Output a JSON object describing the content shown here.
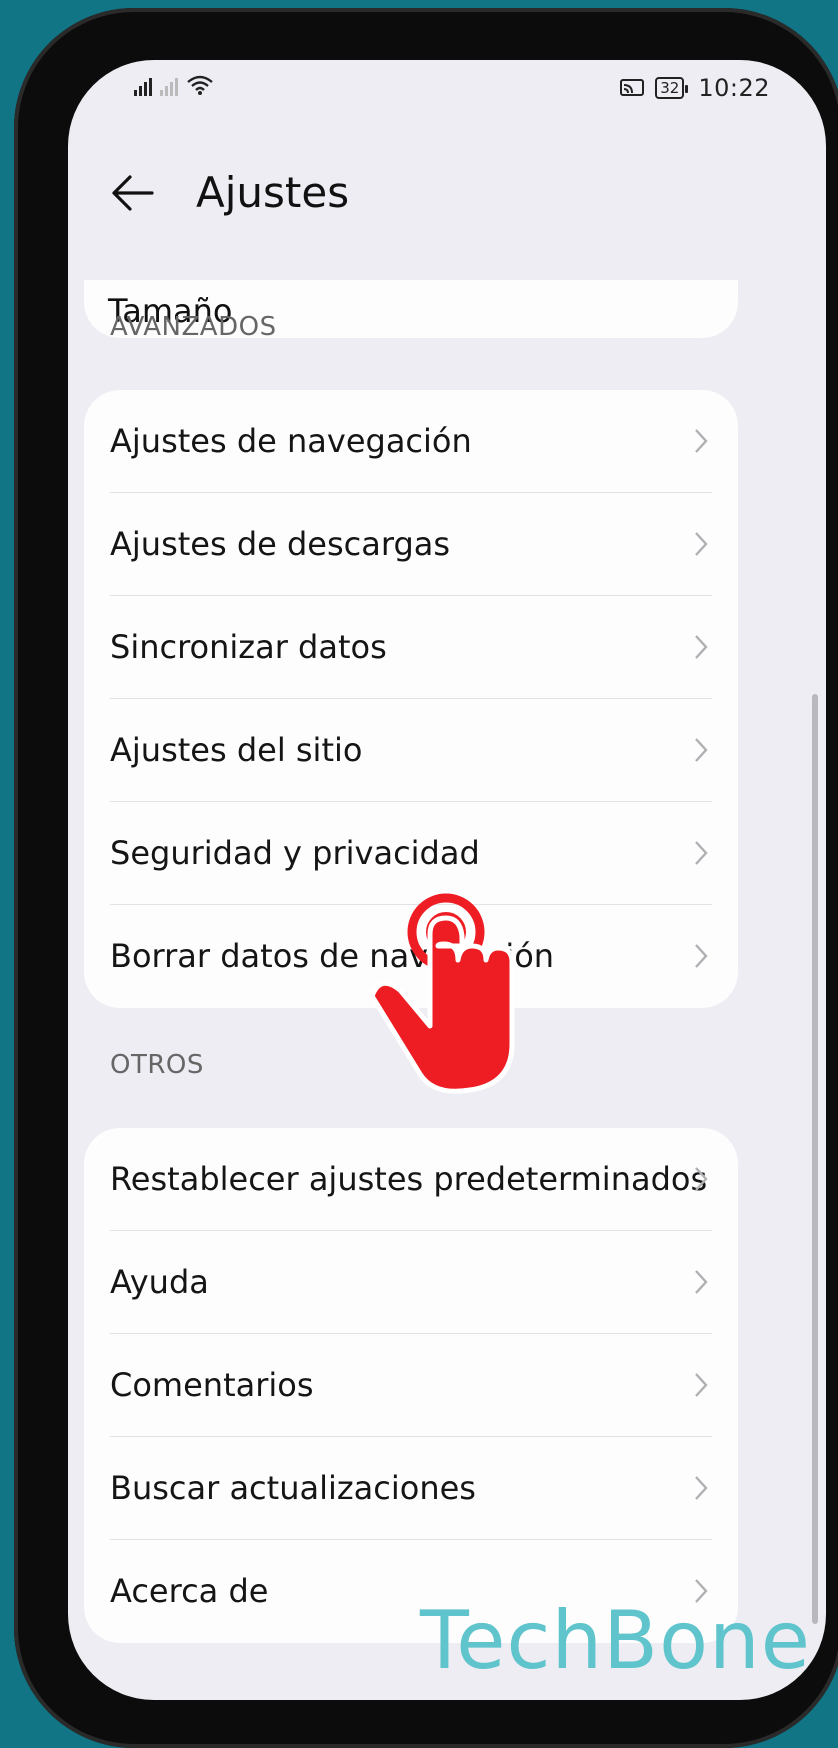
{
  "status_bar": {
    "time": "10:22",
    "battery": "32"
  },
  "header": {
    "title": "Ajustes"
  },
  "top_card": {
    "partial_label": "Tamaño"
  },
  "sections": [
    {
      "label": "AVANZADOS",
      "items": [
        "Ajustes de navegación",
        "Ajustes de descargas",
        "Sincronizar datos",
        "Ajustes del sitio",
        "Seguridad y privacidad",
        "Borrar datos de navegación"
      ]
    },
    {
      "label": "OTROS",
      "items": [
        "Restablecer ajustes predeterminados",
        "Ayuda",
        "Comentarios",
        "Buscar actualizaciones",
        "Acerca de"
      ]
    }
  ],
  "watermark": "TechBone",
  "colors": {
    "background": "#127585",
    "screen": "#eeedf4",
    "card": "#fdfdfd",
    "hand": "#ee1d24",
    "watermark": "#5fc4cc"
  },
  "icons": [
    "signal-icon",
    "wifi-icon",
    "cast-icon",
    "battery-icon",
    "back-arrow-icon",
    "chevron-right-icon",
    "tap-hand-icon"
  ]
}
